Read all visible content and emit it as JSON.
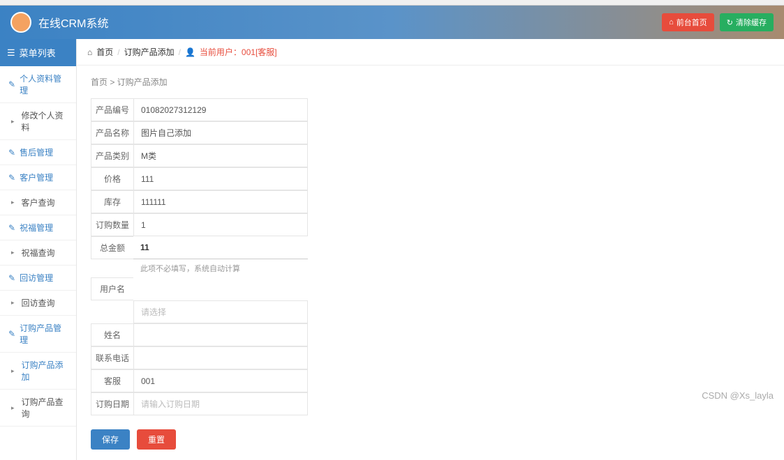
{
  "header": {
    "title": "在线CRM系统",
    "btn_home": "前台首页",
    "btn_cache": "清除缓存"
  },
  "sidebar": {
    "menu_title": "菜单列表",
    "items": [
      {
        "label": "个人资料管理",
        "type": "group"
      },
      {
        "label": "修改个人资料",
        "type": "sub"
      },
      {
        "label": "售后管理",
        "type": "group"
      },
      {
        "label": "客户管理",
        "type": "group"
      },
      {
        "label": "客户查询",
        "type": "sub"
      },
      {
        "label": "祝福管理",
        "type": "group"
      },
      {
        "label": "祝福查询",
        "type": "sub"
      },
      {
        "label": "回访管理",
        "type": "group"
      },
      {
        "label": "回访查询",
        "type": "sub"
      },
      {
        "label": "订购产品管理",
        "type": "group"
      },
      {
        "label": "订购产品添加",
        "type": "sub",
        "active": true
      },
      {
        "label": "订购产品查询",
        "type": "sub"
      }
    ]
  },
  "breadcrumb": {
    "home": "首页",
    "page": "订购产品添加",
    "user_label": "当前用户：001[客服]"
  },
  "sub_bread": "首页  >  订购产品添加",
  "form": {
    "product_no": {
      "label": "产品编号",
      "value": "01082027312129"
    },
    "product_name": {
      "label": "产品名称",
      "value": "图片自己添加"
    },
    "product_type": {
      "label": "产品类别",
      "value": "M类"
    },
    "price": {
      "label": "价格",
      "value": "111"
    },
    "stock": {
      "label": "库存",
      "value": "111111"
    },
    "qty": {
      "label": "订购数量",
      "value": "1"
    },
    "total": {
      "label": "总金额",
      "value": "11",
      "help": "此项不必填写，系统自动计算"
    },
    "username": {
      "label": "用户名",
      "placeholder": "请选择"
    },
    "name": {
      "label": "姓名",
      "value": ""
    },
    "phone": {
      "label": "联系电话",
      "value": ""
    },
    "service": {
      "label": "客服",
      "value": "001"
    },
    "date": {
      "label": "订购日期",
      "placeholder": "请输入订购日期"
    }
  },
  "actions": {
    "save": "保存",
    "reset": "重置"
  },
  "watermark": "CSDN @Xs_layla"
}
